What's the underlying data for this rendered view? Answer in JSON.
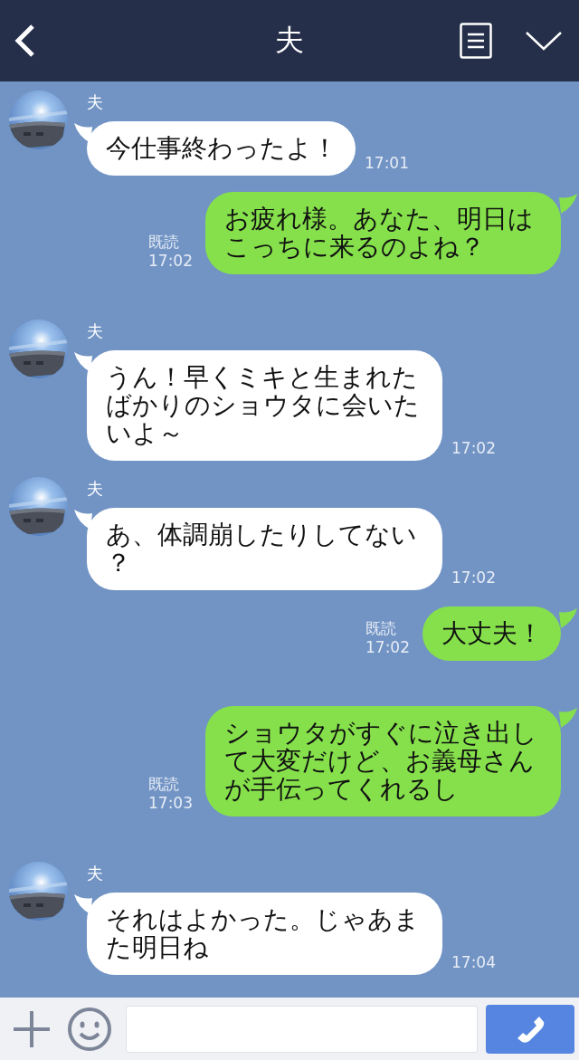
{
  "header": {
    "title": "夫"
  },
  "messages": [
    {
      "kind": "received",
      "sender": "夫",
      "text": "今仕事終わったよ！",
      "time": "17:01"
    },
    {
      "kind": "sent",
      "text": "お疲れ様。あなた、明日はこっちに来るのよね？",
      "read": "既読",
      "time": "17:02"
    },
    {
      "kind": "received",
      "sender": "夫",
      "text": "うん！早くミキと生まれたばかりのショウタに会いたいよ～",
      "time": "17:02"
    },
    {
      "kind": "received",
      "sender": "夫",
      "text": "あ、体調崩したりしてない？",
      "time": "17:02"
    },
    {
      "kind": "sent",
      "text": "大丈夫！",
      "read": "既読",
      "time": "17:02"
    },
    {
      "kind": "sent",
      "text": "ショウタがすぐに泣き出して大変だけど、お義母さんが手伝ってくれるし",
      "read": "既読",
      "time": "17:03"
    },
    {
      "kind": "received",
      "sender": "夫",
      "text": "それはよかった。じゃあまた明日ね",
      "time": "17:04"
    }
  ]
}
